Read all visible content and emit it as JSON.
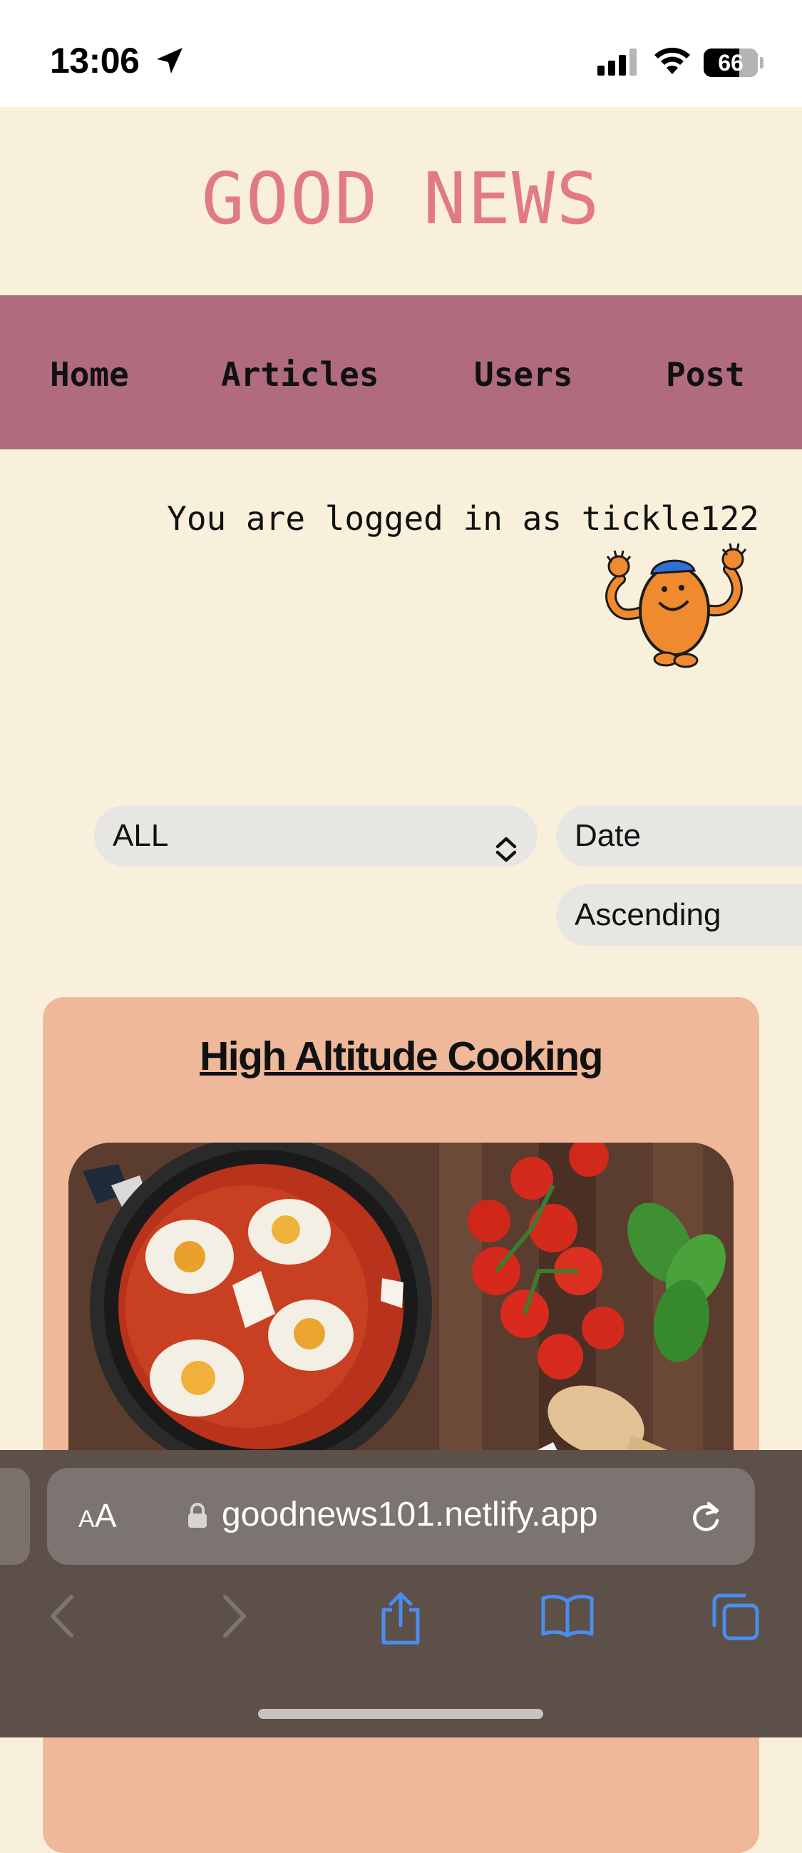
{
  "status_bar": {
    "time": "13:06",
    "battery": "66",
    "icons": [
      "location-arrow-icon",
      "cellular-signal-icon",
      "wifi-icon",
      "battery-icon"
    ]
  },
  "site": {
    "title": "GOOD NEWS"
  },
  "nav": {
    "items": [
      {
        "label": "Home"
      },
      {
        "label": "Articles"
      },
      {
        "label": "Users"
      },
      {
        "label": "Post"
      }
    ]
  },
  "login": {
    "text": "You are logged in as tickle122"
  },
  "filters": {
    "topic": "ALL",
    "sort_by": "Date",
    "order": "Ascending"
  },
  "article": {
    "title": "High Altitude Cooking"
  },
  "browser": {
    "text_size_label": "AA",
    "url": "goodnews101.netlify.app",
    "toolbar_icons": [
      "back-icon",
      "forward-icon",
      "share-icon",
      "bookmarks-icon",
      "tabs-icon"
    ],
    "accent_color": "#4a8cf0"
  },
  "colors": {
    "page_bg": "#f8f0db",
    "title": "#e27a86",
    "nav_bg": "#b06c7e",
    "card_bg": "#efb89a"
  }
}
